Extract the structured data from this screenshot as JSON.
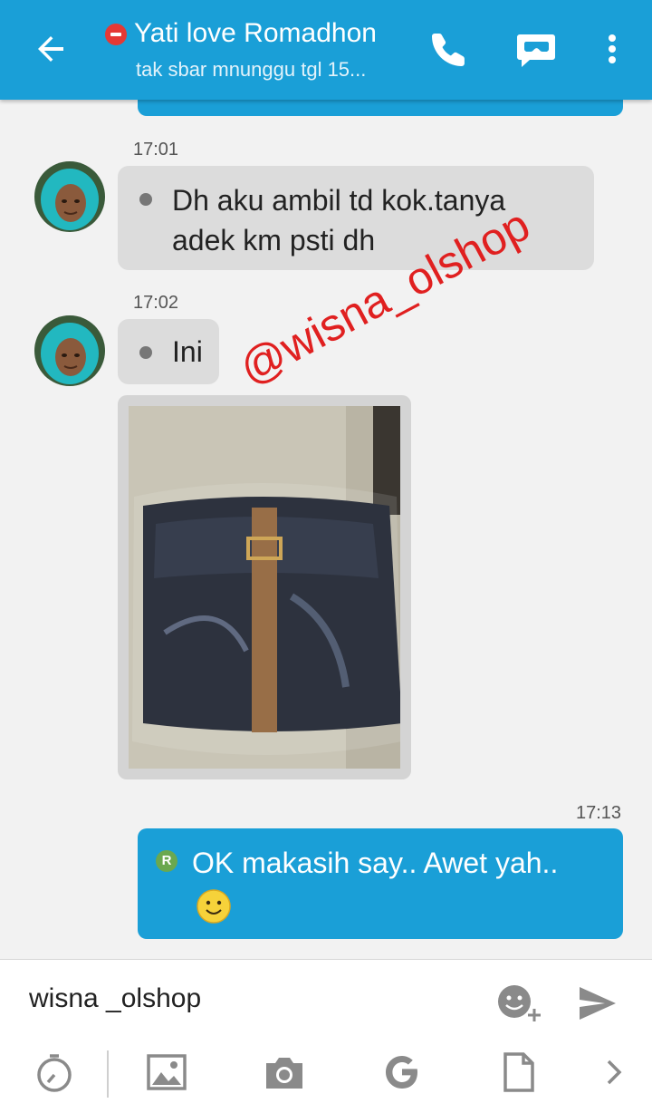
{
  "header": {
    "contact_name": "Yati love Romadhon",
    "status_message": "tak sbar mnunggu tgl 15...",
    "icons": [
      "back-arrow-icon",
      "busy-status-icon",
      "phone-icon",
      "video-chat-icon",
      "more-vert-icon"
    ]
  },
  "messages": [
    {
      "time": "17:01",
      "direction": "incoming",
      "text_line1": "Dh aku ambil td kok.tanya",
      "text_line2": "adek km psti dh"
    },
    {
      "time": "17:02",
      "direction": "incoming",
      "text": "Ini"
    },
    {
      "direction": "incoming",
      "type": "photo",
      "content": "black leather bag with brown strap in plastic wrap"
    },
    {
      "time": "17:13",
      "direction": "outgoing",
      "read_badge": "R",
      "text": "OK makasih say.. Awet yah..",
      "emoji": "smiley-emoji"
    }
  ],
  "watermark": "@wisna_olshop",
  "composer": {
    "value": "wisna _olshop",
    "icons": [
      "emoji-add-icon",
      "send-icon"
    ]
  },
  "toolbar": {
    "icons": [
      "timer-icon",
      "image-icon",
      "camera-icon",
      "google-icon",
      "file-icon",
      "chevron-right-icon"
    ]
  },
  "colors": {
    "accent": "#1a9fd7",
    "incoming_bubble": "#dcdcdc",
    "busy": "#e53935",
    "watermark": "#e02020"
  }
}
